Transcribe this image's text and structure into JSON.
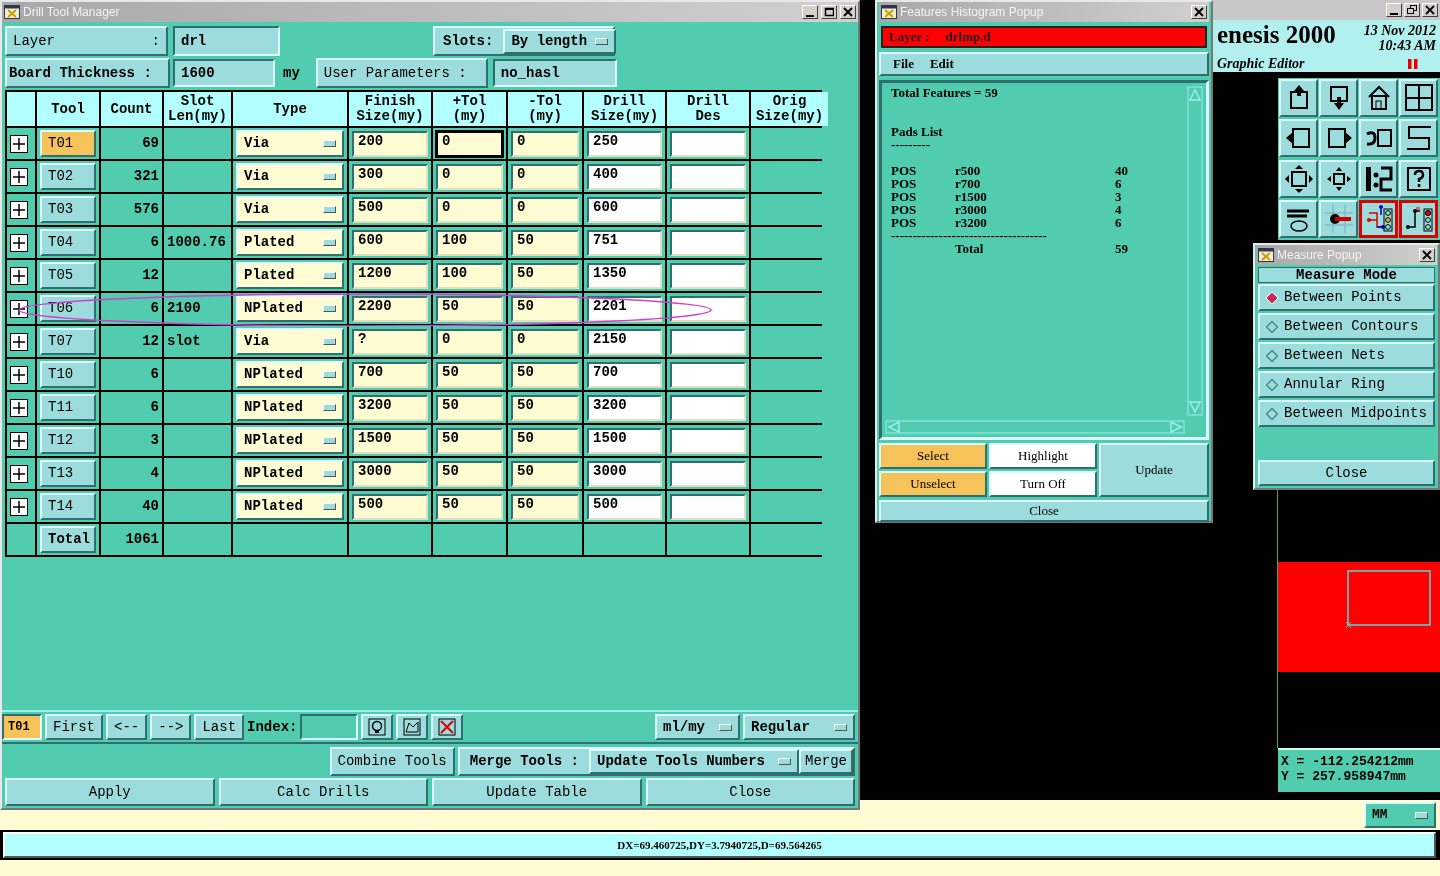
{
  "drill_tool_manager": {
    "title": "Drill Tool Manager",
    "layer": {
      "label": "Layer",
      "colon": ":",
      "value": "drl"
    },
    "slots": {
      "label": "Slots:",
      "value": "By length"
    },
    "board_thickness": {
      "label": "Board Thickness :",
      "value": "1600",
      "unit": "my"
    },
    "user_parameters": {
      "label": "User Parameters :",
      "value": "no_hasl"
    },
    "table": {
      "columns": [
        "Tool",
        "Count",
        "Slot\nLen(my)",
        "Type",
        "Finish\nSize(my)",
        "+Tol\n(my)",
        "-Tol\n(my)",
        "Drill\nSize(my)",
        "Drill\nDes",
        "Orig\nSize(my)"
      ],
      "rows": [
        {
          "tool": "T01",
          "selected": true,
          "count": "69",
          "type": "Via",
          "finish": "200",
          "plus_tol": "0",
          "minus_tol": "0",
          "drill_size": "250",
          "focused": true,
          "circled": false
        },
        {
          "tool": "T02",
          "selected": false,
          "count": "321",
          "type": "Via",
          "finish": "300",
          "plus_tol": "0",
          "minus_tol": "0",
          "drill_size": "400",
          "focused": false,
          "circled": false
        },
        {
          "tool": "T03",
          "selected": false,
          "count": "576",
          "type": "Via",
          "finish": "500",
          "plus_tol": "0",
          "minus_tol": "0",
          "drill_size": "600",
          "focused": false,
          "circled": false
        },
        {
          "tool": "T04",
          "selected": false,
          "count": "6",
          "slot_len": "1000.76",
          "type": "Plated",
          "finish": "600",
          "plus_tol": "100",
          "minus_tol": "50",
          "drill_size": "751",
          "focused": false,
          "circled": false
        },
        {
          "tool": "T05",
          "selected": false,
          "count": "12",
          "type": "Plated",
          "finish": "1200",
          "plus_tol": "100",
          "minus_tol": "50",
          "drill_size": "1350",
          "focused": false,
          "circled": false
        },
        {
          "tool": "T06",
          "selected": false,
          "count": "6",
          "slot_len": "2100",
          "type": "NPlated",
          "finish": "2200",
          "plus_tol": "50",
          "minus_tol": "50",
          "drill_size": "2201",
          "focused": false,
          "circled": true
        },
        {
          "tool": "T07",
          "selected": false,
          "count": "12",
          "slot_len": "slot",
          "type": "Via",
          "finish": "?",
          "plus_tol": "0",
          "minus_tol": "0",
          "drill_size": "2150",
          "focused": false,
          "circled": false
        },
        {
          "tool": "T10",
          "selected": false,
          "count": "6",
          "type": "NPlated",
          "finish": "700",
          "plus_tol": "50",
          "minus_tol": "50",
          "drill_size": "700",
          "focused": false,
          "circled": false
        },
        {
          "tool": "T11",
          "selected": false,
          "count": "6",
          "type": "NPlated",
          "finish": "3200",
          "plus_tol": "50",
          "minus_tol": "50",
          "drill_size": "3200",
          "focused": false,
          "circled": false
        },
        {
          "tool": "T12",
          "selected": false,
          "count": "3",
          "type": "NPlated",
          "finish": "1500",
          "plus_tol": "50",
          "minus_tol": "50",
          "drill_size": "1500",
          "focused": false,
          "circled": false
        },
        {
          "tool": "T13",
          "selected": false,
          "count": "4",
          "type": "NPlated",
          "finish": "3000",
          "plus_tol": "50",
          "minus_tol": "50",
          "drill_size": "3000",
          "focused": false,
          "circled": false
        },
        {
          "tool": "T14",
          "selected": false,
          "count": "40",
          "type": "NPlated",
          "finish": "500",
          "plus_tol": "50",
          "minus_tol": "50",
          "drill_size": "500",
          "focused": false,
          "circled": false
        }
      ],
      "total": {
        "label": "Total",
        "count": "1061"
      }
    },
    "navigation": {
      "current": "T01",
      "buttons": [
        "First",
        "<--",
        "-->",
        "Last"
      ],
      "index_label": "Index:",
      "units": "ml/my",
      "mode": "Regular"
    },
    "merge": {
      "combine": "Combine Tools",
      "label": "Merge Tools :",
      "option": "Update Tools Numbers",
      "merge": "Merge"
    },
    "actions": [
      "Apply",
      "Calc Drills",
      "Update Table",
      "Close"
    ]
  },
  "features_histogram": {
    "title": "Features Histogram Popup",
    "layer_label": "Layer :",
    "layer_value": "drlmp.d",
    "menu": [
      "File",
      "Edit"
    ],
    "summary": "Total Features = 59",
    "section": "Pads List",
    "section_rule": "---------",
    "pads": [
      {
        "type": "POS",
        "symbol": "r500",
        "count": "40"
      },
      {
        "type": "POS",
        "symbol": "r700",
        "count": "6"
      },
      {
        "type": "POS",
        "symbol": "r1500",
        "count": "3"
      },
      {
        "type": "POS",
        "symbol": "r3000",
        "count": "4"
      },
      {
        "type": "POS",
        "symbol": "r3200",
        "count": "6"
      }
    ],
    "rule": "------------------------------------",
    "total_label": "Total",
    "total": "59",
    "buttons": {
      "select": "Select",
      "highlight": "Highlight",
      "update": "Update",
      "unselect": "Unselect",
      "turn_off": "Turn Off",
      "close": "Close"
    }
  },
  "genesis": {
    "title": "enesis 2000",
    "date": "13 Nov 2012",
    "time": "10:43 AM",
    "subtitle": "Graphic Editor",
    "toolbar": [
      {
        "active": false
      },
      {
        "active": false
      },
      {
        "active": false
      },
      {
        "active": false
      },
      {
        "active": false
      },
      {
        "active": false
      },
      {
        "active": false
      },
      {
        "active": false
      },
      {
        "active": false
      },
      {
        "active": false
      },
      {
        "active": false
      },
      {
        "active": false
      },
      {
        "active": false
      },
      {
        "active": false
      },
      {
        "active": true
      },
      {
        "active": true
      }
    ],
    "coordinates": [
      "X = -112.254212mm",
      "Y = 257.958947mm"
    ],
    "units": "MM",
    "status": "DX=69.460725,DY=3.7940725,D=69.564265"
  },
  "measure_popup": {
    "title": "Measure Popup",
    "heading": "Measure Mode",
    "options": [
      {
        "label": "Between Points",
        "selected": true
      },
      {
        "label": "Between Contours",
        "selected": false
      },
      {
        "label": "Between Nets",
        "selected": false
      },
      {
        "label": "Annular Ring",
        "selected": false
      },
      {
        "label": "Between Midpoints",
        "selected": false
      }
    ],
    "close": "Close"
  }
}
